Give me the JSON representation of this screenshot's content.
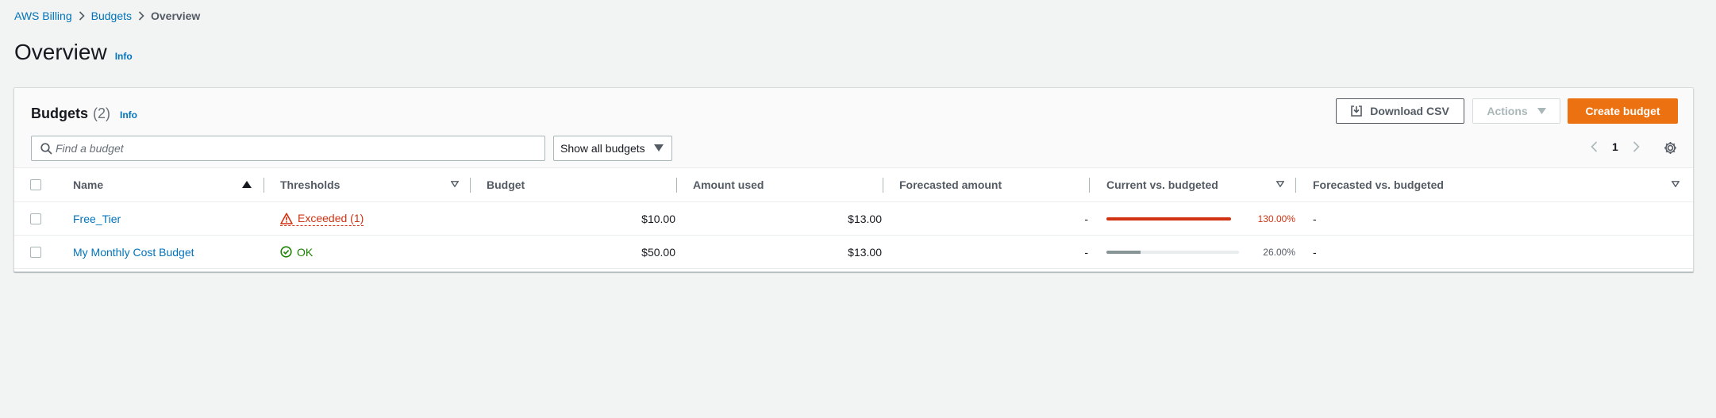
{
  "breadcrumb": {
    "items": [
      "AWS Billing",
      "Budgets"
    ],
    "current": "Overview"
  },
  "page": {
    "title": "Overview",
    "info": "Info"
  },
  "budgets_panel": {
    "title": "Budgets",
    "count": "(2)",
    "info": "Info",
    "download_label": "Download CSV",
    "actions_label": "Actions",
    "create_label": "Create budget",
    "search_placeholder": "Find a budget",
    "filter_selected": "Show all budgets",
    "page_number": "1"
  },
  "table": {
    "columns": [
      "Name",
      "Thresholds",
      "Budget",
      "Amount used",
      "Forecasted amount",
      "Current vs. budgeted",
      "Forecasted vs. budgeted"
    ],
    "rows": [
      {
        "name": "Free_Tier",
        "threshold": "Exceeded (1)",
        "threshold_status": "exceeded",
        "budget": "$10.00",
        "amount_used": "$13.00",
        "forecasted_amount": "-",
        "current_vs_budgeted": "130.00%",
        "current_ratio": 1.3,
        "forecasted_vs_budgeted": "-"
      },
      {
        "name": "My Monthly Cost Budget",
        "threshold": "OK",
        "threshold_status": "ok",
        "budget": "$50.00",
        "amount_used": "$13.00",
        "forecasted_amount": "-",
        "current_vs_budgeted": "26.00%",
        "current_ratio": 0.26,
        "forecasted_vs_budgeted": "-"
      }
    ]
  },
  "colors": {
    "link": "#0073bb",
    "primary_button": "#ec7211",
    "exceeded": "#d13212",
    "ok": "#1d8102",
    "progress_over": "#d13212",
    "progress_normal": "#879596"
  }
}
